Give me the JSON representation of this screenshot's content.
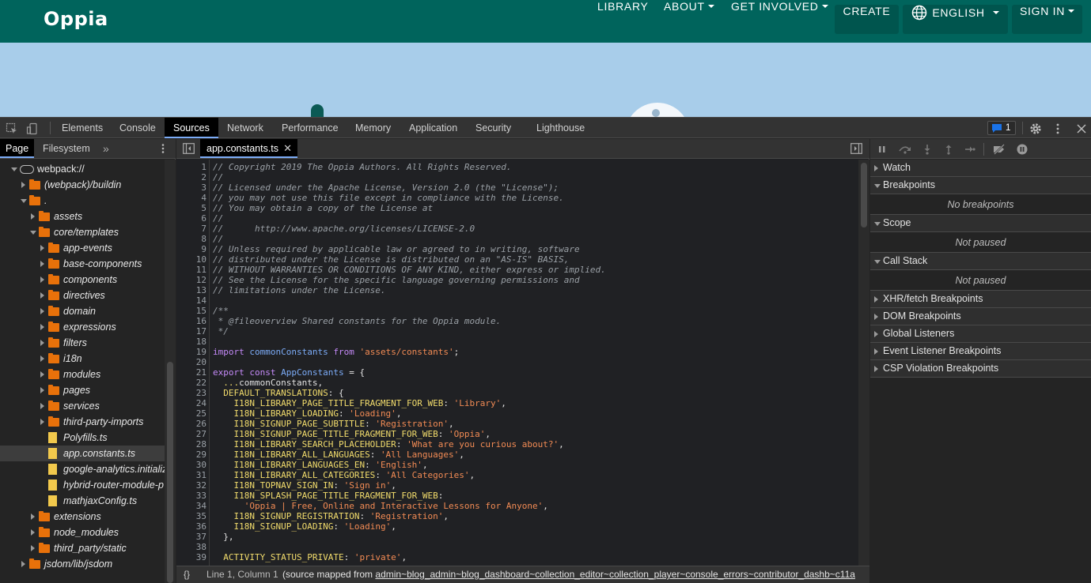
{
  "oppia": {
    "logo": "Oppia",
    "nav": {
      "library": "LIBRARY",
      "about": "ABOUT",
      "get_involved": "GET INVOLVED",
      "create": "CREATE",
      "language": "ENGLISH",
      "sign_in": "SIGN IN"
    }
  },
  "devtools": {
    "tabs": [
      "Elements",
      "Console",
      "Sources",
      "Network",
      "Performance",
      "Memory",
      "Application",
      "Security",
      "Lighthouse"
    ],
    "active_tab": "Sources",
    "issues_count": "1",
    "navigator": {
      "tabs": [
        "Page",
        "Filesystem"
      ],
      "more": "»",
      "tree": [
        {
          "label": "webpack://",
          "depth": 0,
          "kind": "cloud",
          "expanded": true
        },
        {
          "label": "(webpack)/buildin",
          "depth": 1,
          "kind": "folder",
          "expanded": false
        },
        {
          "label": ".",
          "depth": 1,
          "kind": "folder",
          "expanded": true
        },
        {
          "label": "assets",
          "depth": 2,
          "kind": "folder",
          "expanded": false
        },
        {
          "label": "core/templates",
          "depth": 2,
          "kind": "folder",
          "expanded": true
        },
        {
          "label": "app-events",
          "depth": 3,
          "kind": "folder",
          "expanded": false
        },
        {
          "label": "base-components",
          "depth": 3,
          "kind": "folder",
          "expanded": false
        },
        {
          "label": "components",
          "depth": 3,
          "kind": "folder",
          "expanded": false
        },
        {
          "label": "directives",
          "depth": 3,
          "kind": "folder",
          "expanded": false
        },
        {
          "label": "domain",
          "depth": 3,
          "kind": "folder",
          "expanded": false
        },
        {
          "label": "expressions",
          "depth": 3,
          "kind": "folder",
          "expanded": false
        },
        {
          "label": "filters",
          "depth": 3,
          "kind": "folder",
          "expanded": false
        },
        {
          "label": "i18n",
          "depth": 3,
          "kind": "folder",
          "expanded": false
        },
        {
          "label": "modules",
          "depth": 3,
          "kind": "folder",
          "expanded": false
        },
        {
          "label": "pages",
          "depth": 3,
          "kind": "folder",
          "expanded": false
        },
        {
          "label": "services",
          "depth": 3,
          "kind": "folder",
          "expanded": false
        },
        {
          "label": "third-party-imports",
          "depth": 3,
          "kind": "folder",
          "expanded": false
        },
        {
          "label": "Polyfills.ts",
          "depth": 3,
          "kind": "file"
        },
        {
          "label": "app.constants.ts",
          "depth": 3,
          "kind": "file",
          "selected": true
        },
        {
          "label": "google-analytics.initializ",
          "depth": 3,
          "kind": "file"
        },
        {
          "label": "hybrid-router-module-p",
          "depth": 3,
          "kind": "file"
        },
        {
          "label": "mathjaxConfig.ts",
          "depth": 3,
          "kind": "file"
        },
        {
          "label": "extensions",
          "depth": 2,
          "kind": "folder",
          "expanded": false
        },
        {
          "label": "node_modules",
          "depth": 2,
          "kind": "folder",
          "expanded": false
        },
        {
          "label": "third_party/static",
          "depth": 2,
          "kind": "folder",
          "expanded": false
        },
        {
          "label": "jsdom/lib/jsdom",
          "depth": 1,
          "kind": "folder",
          "expanded": false
        }
      ]
    },
    "editor": {
      "tab": "app.constants.ts",
      "lines": [
        {
          "n": "1",
          "t": [
            [
              "com",
              "// Copyright 2019 The Oppia Authors. All Rights Reserved."
            ]
          ]
        },
        {
          "n": "2",
          "t": [
            [
              "com",
              "//"
            ]
          ]
        },
        {
          "n": "3",
          "t": [
            [
              "com",
              "// Licensed under the Apache License, Version 2.0 (the \"License\");"
            ]
          ]
        },
        {
          "n": "4",
          "t": [
            [
              "com",
              "// you may not use this file except in compliance with the License."
            ]
          ]
        },
        {
          "n": "5",
          "t": [
            [
              "com",
              "// You may obtain a copy of the License at"
            ]
          ]
        },
        {
          "n": "6",
          "t": [
            [
              "com",
              "//"
            ]
          ]
        },
        {
          "n": "7",
          "t": [
            [
              "com",
              "//      http://www.apache.org/licenses/LICENSE-2.0"
            ]
          ]
        },
        {
          "n": "8",
          "t": [
            [
              "com",
              "//"
            ]
          ]
        },
        {
          "n": "9",
          "t": [
            [
              "com",
              "// Unless required by applicable law or agreed to in writing, software"
            ]
          ]
        },
        {
          "n": "10",
          "t": [
            [
              "com",
              "// distributed under the License is distributed on an \"AS-IS\" BASIS,"
            ]
          ]
        },
        {
          "n": "11",
          "t": [
            [
              "com",
              "// WITHOUT WARRANTIES OR CONDITIONS OF ANY KIND, either express or implied."
            ]
          ]
        },
        {
          "n": "12",
          "t": [
            [
              "com",
              "// See the License for the specific language governing permissions and"
            ]
          ]
        },
        {
          "n": "13",
          "t": [
            [
              "com",
              "// limitations under the License."
            ]
          ]
        },
        {
          "n": "14",
          "t": []
        },
        {
          "n": "15",
          "t": [
            [
              "com",
              "/**"
            ]
          ]
        },
        {
          "n": "16",
          "t": [
            [
              "com",
              " * @fileoverview Shared constants for the Oppia module."
            ]
          ]
        },
        {
          "n": "17",
          "t": [
            [
              "com",
              " */"
            ]
          ]
        },
        {
          "n": "18",
          "t": []
        },
        {
          "n": "19",
          "t": [
            [
              "kw",
              "import "
            ],
            [
              "id",
              "commonConstants "
            ],
            [
              "kw",
              "from "
            ],
            [
              "str",
              "'assets/constants'"
            ],
            [
              "plain",
              ";"
            ]
          ]
        },
        {
          "n": "20",
          "t": []
        },
        {
          "n": "21",
          "t": [
            [
              "kw",
              "export const "
            ],
            [
              "id",
              "AppConstants "
            ],
            [
              "plain",
              "= {"
            ]
          ]
        },
        {
          "n": "22",
          "t": [
            [
              "plain",
              "  "
            ],
            [
              "prop",
              "..."
            ],
            [
              "plain",
              "commonConstants,"
            ]
          ]
        },
        {
          "n": "23",
          "t": [
            [
              "plain",
              "  "
            ],
            [
              "prop",
              "DEFAULT_TRANSLATIONS"
            ],
            [
              "plain",
              ": {"
            ]
          ]
        },
        {
          "n": "24",
          "t": [
            [
              "plain",
              "    "
            ],
            [
              "prop",
              "I18N_LIBRARY_PAGE_TITLE_FRAGMENT_FOR_WEB"
            ],
            [
              "plain",
              ": "
            ],
            [
              "str",
              "'Library'"
            ],
            [
              "plain",
              ","
            ]
          ]
        },
        {
          "n": "25",
          "t": [
            [
              "plain",
              "    "
            ],
            [
              "prop",
              "I18N_LIBRARY_LOADING"
            ],
            [
              "plain",
              ": "
            ],
            [
              "str",
              "'Loading'"
            ],
            [
              "plain",
              ","
            ]
          ]
        },
        {
          "n": "26",
          "t": [
            [
              "plain",
              "    "
            ],
            [
              "prop",
              "I18N_SIGNUP_PAGE_SUBTITLE"
            ],
            [
              "plain",
              ": "
            ],
            [
              "str",
              "'Registration'"
            ],
            [
              "plain",
              ","
            ]
          ]
        },
        {
          "n": "27",
          "t": [
            [
              "plain",
              "    "
            ],
            [
              "prop",
              "I18N_SIGNUP_PAGE_TITLE_FRAGMENT_FOR_WEB"
            ],
            [
              "plain",
              ": "
            ],
            [
              "str",
              "'Oppia'"
            ],
            [
              "plain",
              ","
            ]
          ]
        },
        {
          "n": "28",
          "t": [
            [
              "plain",
              "    "
            ],
            [
              "prop",
              "I18N_LIBRARY_SEARCH_PLACEHOLDER"
            ],
            [
              "plain",
              ": "
            ],
            [
              "str",
              "'What are you curious about?'"
            ],
            [
              "plain",
              ","
            ]
          ]
        },
        {
          "n": "29",
          "t": [
            [
              "plain",
              "    "
            ],
            [
              "prop",
              "I18N_LIBRARY_ALL_LANGUAGES"
            ],
            [
              "plain",
              ": "
            ],
            [
              "str",
              "'All Languages'"
            ],
            [
              "plain",
              ","
            ]
          ]
        },
        {
          "n": "30",
          "t": [
            [
              "plain",
              "    "
            ],
            [
              "prop",
              "I18N_LIBRARY_LANGUAGES_EN"
            ],
            [
              "plain",
              ": "
            ],
            [
              "str",
              "'English'"
            ],
            [
              "plain",
              ","
            ]
          ]
        },
        {
          "n": "31",
          "t": [
            [
              "plain",
              "    "
            ],
            [
              "prop",
              "I18N_LIBRARY_ALL_CATEGORIES"
            ],
            [
              "plain",
              ": "
            ],
            [
              "str",
              "'All Categories'"
            ],
            [
              "plain",
              ","
            ]
          ]
        },
        {
          "n": "32",
          "t": [
            [
              "plain",
              "    "
            ],
            [
              "prop",
              "I18N_TOPNAV_SIGN_IN"
            ],
            [
              "plain",
              ": "
            ],
            [
              "str",
              "'Sign in'"
            ],
            [
              "plain",
              ","
            ]
          ]
        },
        {
          "n": "33",
          "t": [
            [
              "plain",
              "    "
            ],
            [
              "prop",
              "I18N_SPLASH_PAGE_TITLE_FRAGMENT_FOR_WEB"
            ],
            [
              "plain",
              ":"
            ]
          ]
        },
        {
          "n": "34",
          "t": [
            [
              "plain",
              "      "
            ],
            [
              "str",
              "'Oppia | Free, Online and Interactive Lessons for Anyone'"
            ],
            [
              "plain",
              ","
            ]
          ]
        },
        {
          "n": "35",
          "t": [
            [
              "plain",
              "    "
            ],
            [
              "prop",
              "I18N_SIGNUP_REGISTRATION"
            ],
            [
              "plain",
              ": "
            ],
            [
              "str",
              "'Registration'"
            ],
            [
              "plain",
              ","
            ]
          ]
        },
        {
          "n": "36",
          "t": [
            [
              "plain",
              "    "
            ],
            [
              "prop",
              "I18N_SIGNUP_LOADING"
            ],
            [
              "plain",
              ": "
            ],
            [
              "str",
              "'Loading'"
            ],
            [
              "plain",
              ","
            ]
          ]
        },
        {
          "n": "37",
          "t": [
            [
              "plain",
              "  },"
            ]
          ]
        },
        {
          "n": "38",
          "t": []
        },
        {
          "n": "39",
          "t": [
            [
              "plain",
              "  "
            ],
            [
              "prop",
              "ACTIVITY_STATUS_PRIVATE"
            ],
            [
              "plain",
              ": "
            ],
            [
              "str",
              "'private'"
            ],
            [
              "plain",
              ","
            ]
          ]
        }
      ],
      "status": {
        "braces": "{}",
        "position": "Line 1, Column 1",
        "mapped_prefix": "(source mapped from ",
        "mapped_link": "admin~blog_admin~blog_dashboard~collection_editor~collection_player~console_errors~contributor_dashb~c11a"
      }
    },
    "debugger": {
      "panes": [
        {
          "label": "Watch",
          "expanded": false
        },
        {
          "label": "Breakpoints",
          "expanded": true,
          "body": "No breakpoints"
        },
        {
          "label": "Scope",
          "expanded": true,
          "body": "Not paused"
        },
        {
          "label": "Call Stack",
          "expanded": true,
          "body": "Not paused"
        },
        {
          "label": "XHR/fetch Breakpoints",
          "expanded": false
        },
        {
          "label": "DOM Breakpoints",
          "expanded": false
        },
        {
          "label": "Global Listeners",
          "expanded": false
        },
        {
          "label": "Event Listener Breakpoints",
          "expanded": false
        },
        {
          "label": "CSP Violation Breakpoints",
          "expanded": false
        }
      ]
    }
  }
}
